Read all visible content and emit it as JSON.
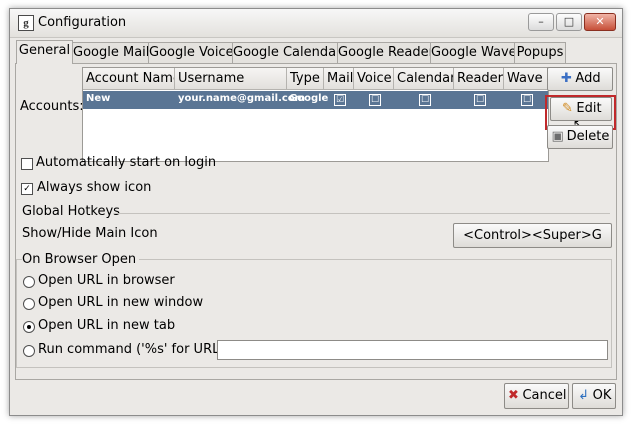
{
  "window": {
    "title": "Configuration",
    "app_icon_glyph": "g",
    "minimize_glyph": "–",
    "maximize_glyph": "□",
    "close_glyph": "✕"
  },
  "tabs": [
    {
      "label": "General",
      "active": true
    },
    {
      "label": "Google Mail"
    },
    {
      "label": "Google Voice"
    },
    {
      "label": "Google Calendar"
    },
    {
      "label": "Google Reader"
    },
    {
      "label": "Google Wave"
    },
    {
      "label": "Popups"
    }
  ],
  "accounts": {
    "label": "Accounts:",
    "columns": [
      "Account Name",
      "Username",
      "Type",
      "Mail",
      "Voice",
      "Calendar",
      "Reader",
      "Wave"
    ],
    "rows": [
      {
        "account_name": "New",
        "username": "your.name@gmail.com",
        "type": "Google",
        "mail": "☑",
        "voice": "☐",
        "calendar": "☐",
        "reader": "☐",
        "wave": "☐"
      }
    ],
    "add_label": "Add",
    "edit_label": "Edit",
    "delete_label": "Delete",
    "add_icon": "plus-icon",
    "edit_icon": "pencil-icon",
    "delete_icon": "trash-icon"
  },
  "options": {
    "auto_start_label": "Automatically start on login",
    "auto_start_checked": false,
    "always_show_label": "Always show icon",
    "always_show_checked": true,
    "check_mark": "✓"
  },
  "hotkeys": {
    "group_label": "Global Hotkeys",
    "show_hide_label": "Show/Hide Main Icon",
    "show_hide_value": "<Control><Super>G"
  },
  "browser": {
    "group_label": "On Browser Open",
    "options": [
      {
        "label": "Open URL in browser",
        "selected": false
      },
      {
        "label": "Open URL in new window",
        "selected": false
      },
      {
        "label": "Open URL in new tab",
        "selected": true
      },
      {
        "label": "Run command ('%s' for URL)",
        "selected": false
      }
    ],
    "command_value": ""
  },
  "footer": {
    "cancel_label": "Cancel",
    "ok_label": "OK",
    "cancel_icon": "cancel-x-icon",
    "ok_icon": "ok-arrow-icon"
  },
  "colors": {
    "selection": "#5a7594",
    "highlight_box": "#c0292b",
    "window_bg": "#ebe9e6"
  }
}
